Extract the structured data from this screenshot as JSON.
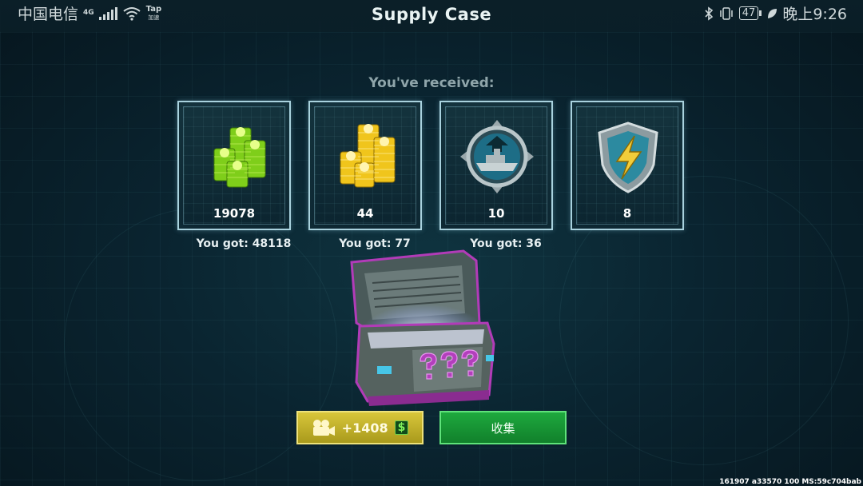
{
  "status_bar": {
    "carrier": "中国电信",
    "network": "4G",
    "tap_label": "Tap",
    "tap_sub": "加速",
    "battery": "47",
    "time": "晚上9:26"
  },
  "header": {
    "title": "Supply Case"
  },
  "rewards": {
    "heading": "You've received:",
    "items": [
      {
        "icon": "green-currency-stacks-icon",
        "amount": "19078",
        "total": "You got: 48118"
      },
      {
        "icon": "gold-currency-stacks-icon",
        "amount": "44",
        "total": "You got: 77"
      },
      {
        "icon": "warship-emblem-icon",
        "amount": "10",
        "total": "You got: 36"
      },
      {
        "icon": "lightning-shield-icon",
        "amount": "8",
        "total": ""
      }
    ]
  },
  "chest": {
    "icon": "mystery-supply-chest-icon"
  },
  "actions": {
    "watch_ad_label": "+1408",
    "watch_ad_currency": "$",
    "collect_label": "收集"
  },
  "debug_text": "161907 a33570 100 MS:59c704bab",
  "colors": {
    "card_border": "#a9d2de",
    "ad_button": "#c9b72e",
    "collect_button": "#1a9a37"
  }
}
